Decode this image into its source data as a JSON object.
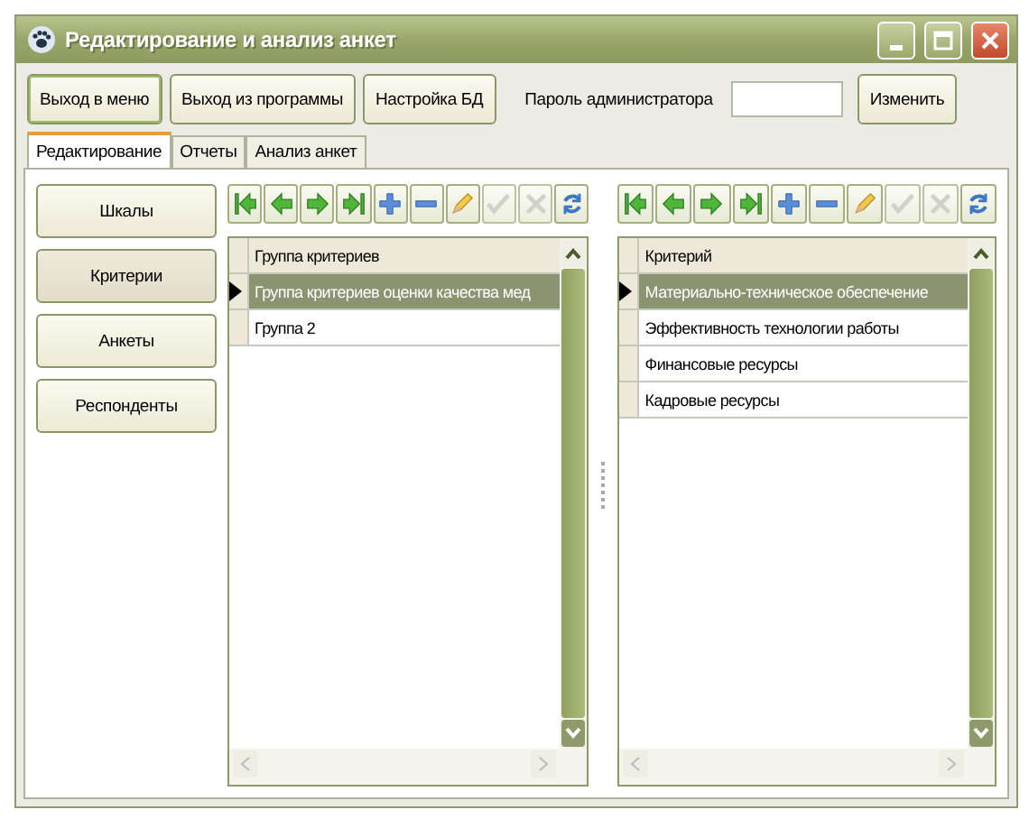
{
  "window": {
    "title": "Редактирование и анализ анкет"
  },
  "top_buttons": [
    "Выход в меню",
    "Выход из программы",
    "Настройка БД"
  ],
  "password": {
    "label": "Пароль администратора",
    "button": "Изменить"
  },
  "tabs": [
    {
      "label": "Редактирование",
      "selected": true
    },
    {
      "label": "Отчеты",
      "selected": false
    },
    {
      "label": "Анализ анкет",
      "selected": false
    }
  ],
  "sidebar": [
    {
      "label": "Шкалы",
      "selected": false
    },
    {
      "label": "Критерии",
      "selected": true
    },
    {
      "label": "Анкеты",
      "selected": false
    },
    {
      "label": "Респонденты",
      "selected": false
    }
  ],
  "grids": [
    {
      "toolbar": [
        {
          "kind": "first",
          "disabled": false
        },
        {
          "kind": "prev",
          "disabled": false
        },
        {
          "kind": "next",
          "disabled": false
        },
        {
          "kind": "last",
          "disabled": false
        },
        {
          "kind": "add",
          "disabled": false
        },
        {
          "kind": "remove",
          "disabled": false
        },
        {
          "kind": "edit",
          "disabled": false
        },
        {
          "kind": "confirm",
          "disabled": true
        },
        {
          "kind": "cancel",
          "disabled": true
        },
        {
          "kind": "refresh",
          "disabled": false
        }
      ],
      "column": "Группа критериев",
      "rows": [
        {
          "text": "Группа критериев оценки качества мед",
          "selected": true
        },
        {
          "text": "Группа 2",
          "selected": false
        }
      ]
    },
    {
      "toolbar": [
        {
          "kind": "first",
          "disabled": false
        },
        {
          "kind": "prev",
          "disabled": false
        },
        {
          "kind": "next",
          "disabled": false
        },
        {
          "kind": "last",
          "disabled": false
        },
        {
          "kind": "add",
          "disabled": false
        },
        {
          "kind": "remove",
          "disabled": false
        },
        {
          "kind": "edit",
          "disabled": false
        },
        {
          "kind": "confirm",
          "disabled": true
        },
        {
          "kind": "cancel",
          "disabled": true
        },
        {
          "kind": "refresh",
          "disabled": false
        }
      ],
      "column": "Критерий",
      "rows": [
        {
          "text": "Материально-техническое обеспечение",
          "selected": true
        },
        {
          "text": "Эффективность технологии работы",
          "selected": false
        },
        {
          "text": "Финансовые ресурсы",
          "selected": false
        },
        {
          "text": "Кадровые ресурсы",
          "selected": false
        }
      ]
    }
  ]
}
